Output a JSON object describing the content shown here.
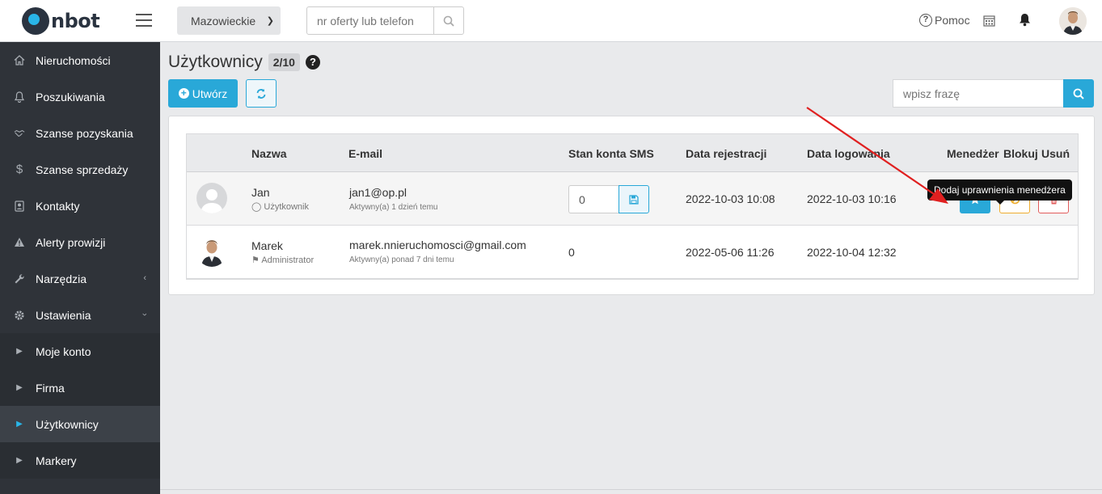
{
  "app": {
    "logo_text": "nbot",
    "brand_color": "#29a8d8"
  },
  "topbar": {
    "region_selected": "Mazowieckie",
    "search_placeholder": "nr oferty lub telefon",
    "help_label": "Pomoc",
    "icons": [
      "hamburger-icon",
      "search-icon",
      "question-icon",
      "calendar-icon",
      "bell-icon",
      "user-avatar"
    ]
  },
  "sidebar": {
    "items": [
      {
        "label": "Nieruchomości",
        "icon": "home-icon"
      },
      {
        "label": "Poszukiwania",
        "icon": "bell-icon"
      },
      {
        "label": "Szanse pozyskania",
        "icon": "handshake-icon"
      },
      {
        "label": "Szanse sprzedaży",
        "icon": "dollar-icon"
      },
      {
        "label": "Kontakty",
        "icon": "contact-card-icon"
      },
      {
        "label": "Alerty prowizji",
        "icon": "warning-icon"
      },
      {
        "label": "Narzędzia",
        "icon": "wrench-icon"
      },
      {
        "label": "Ustawienia",
        "icon": "gear-icon"
      }
    ],
    "subitems": [
      {
        "label": "Moje konto"
      },
      {
        "label": "Firma"
      },
      {
        "label": "Użytkownicy",
        "active": true
      },
      {
        "label": "Markery"
      }
    ]
  },
  "page": {
    "title": "Użytkownicy",
    "count": "2/10",
    "create_label": "Utwórz",
    "search_placeholder": "wpisz frazę"
  },
  "table": {
    "headers": {
      "name": "Nazwa",
      "email": "E-mail",
      "sms": "Stan konta SMS",
      "registered": "Data rejestracji",
      "login": "Data logowania",
      "manager": "Menedżer",
      "block": "Blokuj",
      "delete": "Usuń"
    },
    "rows": [
      {
        "name": "Jan",
        "role": "Użytkownik",
        "email": "jan1@op.pl",
        "activity": "Aktywny(a) 1 dzień temu",
        "sms": "0",
        "registered": "2022-10-03 10:08",
        "login": "2022-10-03 10:16"
      },
      {
        "name": "Marek",
        "role": "Administrator",
        "email": "marek.nnieruchomosci@gmail.com",
        "activity": "Aktywny(a) ponad 7 dni temu",
        "sms": "0",
        "registered": "2022-05-06 11:26",
        "login": "2022-10-04 12:32"
      }
    ]
  },
  "tooltip": {
    "text": "Dodaj uprawnienia menedżera"
  }
}
